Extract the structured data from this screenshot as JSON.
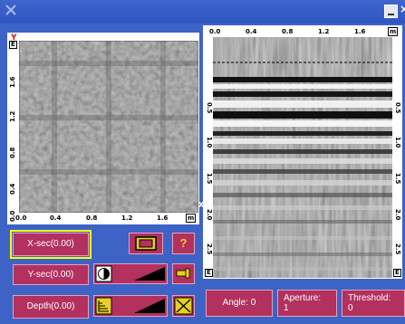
{
  "window": {
    "minimize_icon": "minimize-icon",
    "close_label": "×"
  },
  "left_panel": {
    "axis_unit": "m",
    "y_axis_mark": "Y",
    "x_ticks": [
      "0.0",
      "0.4",
      "0.8",
      "1.2",
      "1.6"
    ],
    "y_ticks": [
      "0.0",
      "0.4",
      "0.8",
      "1.2",
      "1.6"
    ],
    "e_marker": "E",
    "x_axis_mark": "X"
  },
  "right_panel": {
    "axis_unit": "m",
    "x_ticks": [
      "0.0",
      "0.4",
      "0.8",
      "1.2",
      "1.6"
    ],
    "depth_ticks": [
      "0.5",
      "1.0",
      "1.5",
      "2.0",
      "2.5"
    ],
    "e_marker": "E"
  },
  "controls": {
    "xsec_label": "X-sec(0.00)",
    "ysec_label": "Y-sec(0.00)",
    "depth_label": "Depth(0.00)",
    "help_label": "?",
    "angle_label": "Angle: 0",
    "aperture_label": "Aperture:",
    "aperture_value": "1",
    "threshold_label": "Threshold:",
    "threshold_value": "0"
  },
  "colors": {
    "accent": "#b2315e",
    "selected_outline": "#ffff00",
    "background": "#3d63c6"
  }
}
